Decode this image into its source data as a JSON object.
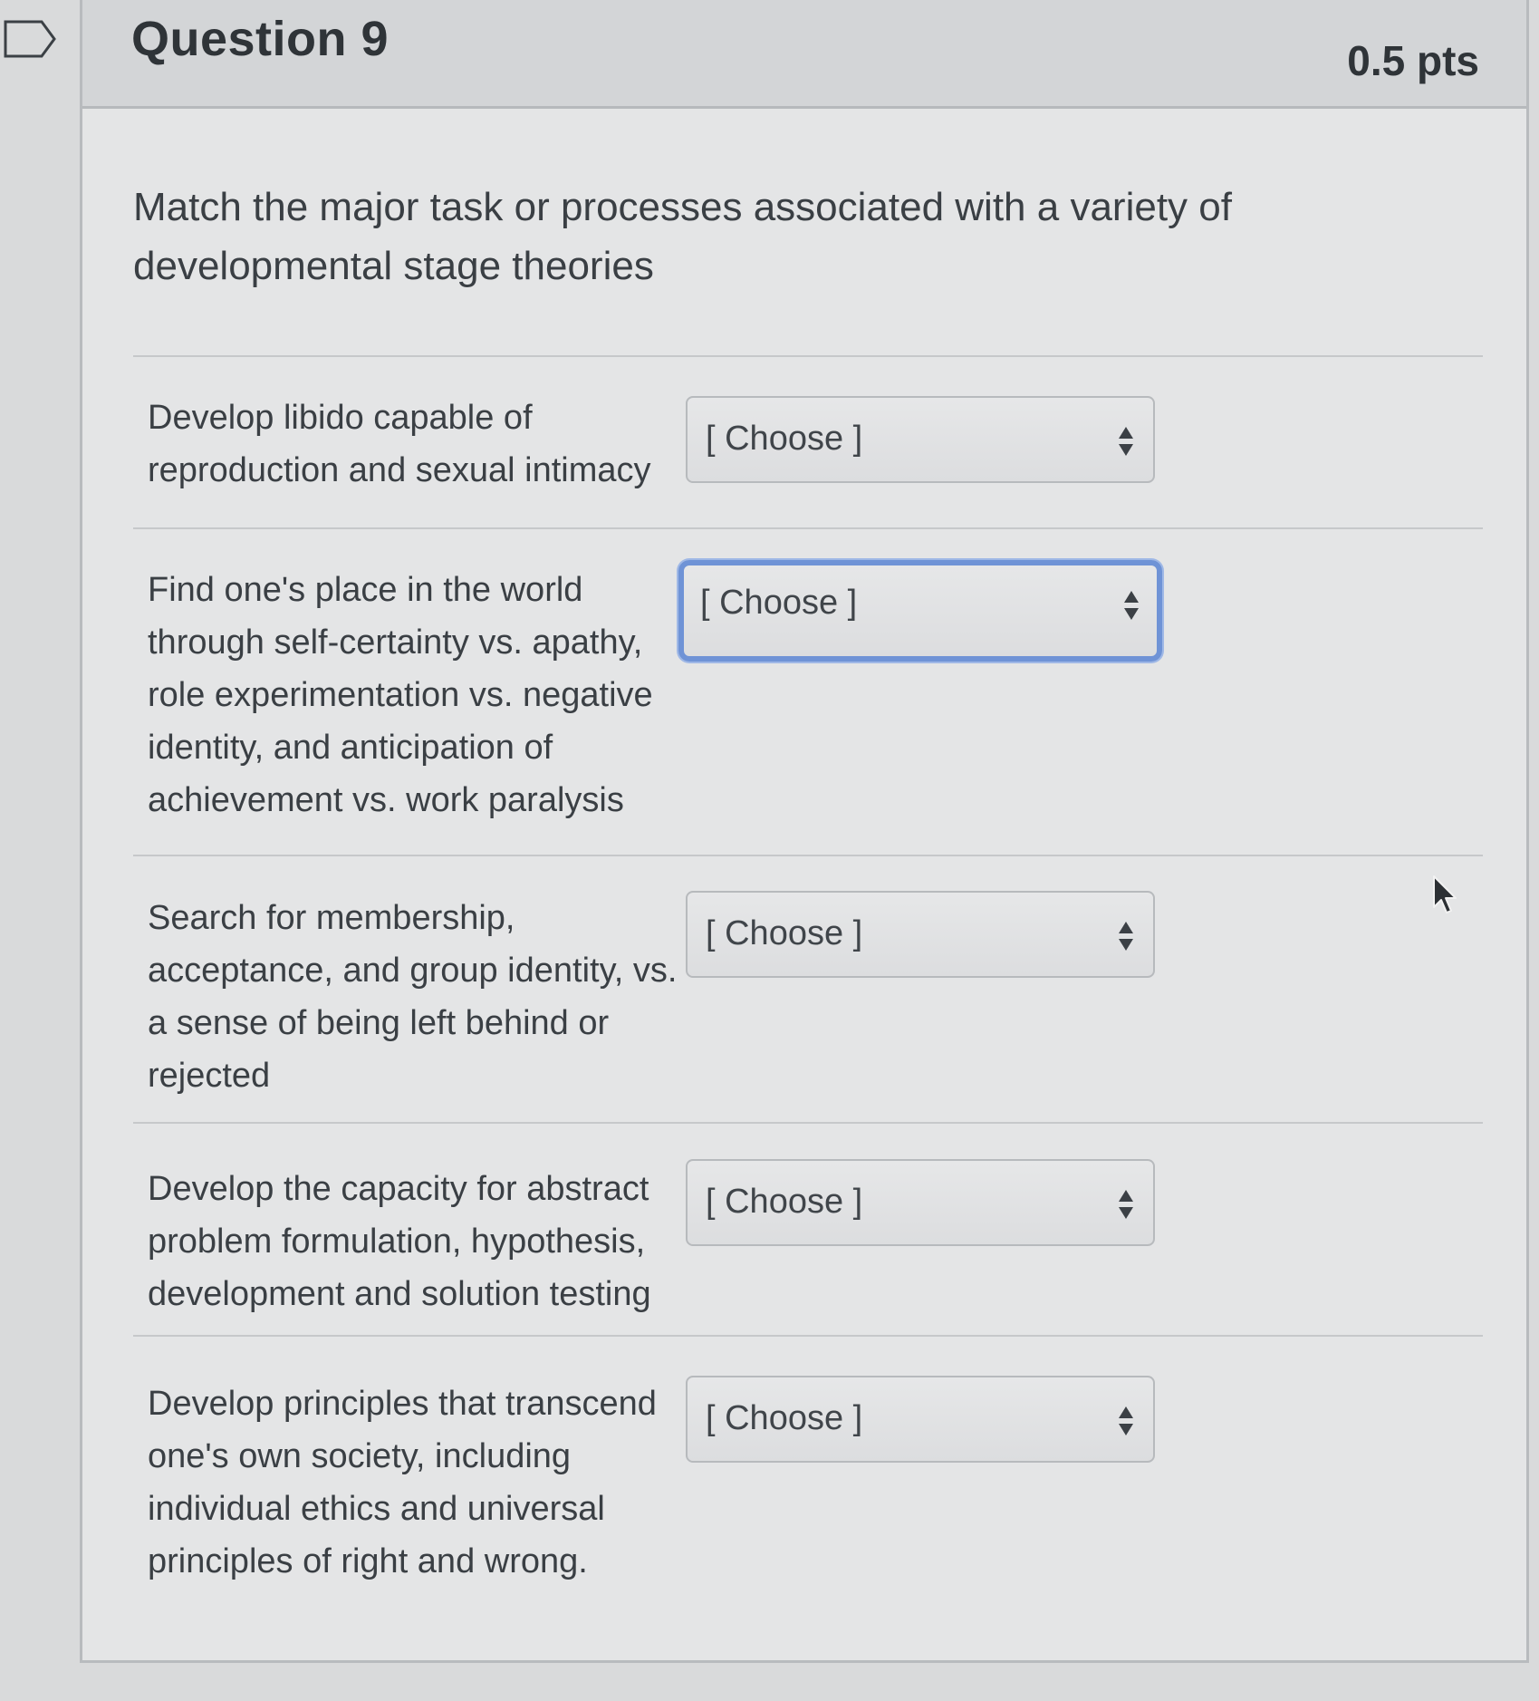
{
  "question": {
    "title": "Question 9",
    "points": "0.5 pts",
    "prompt": "Match the major task or processes associated with a variety of developmental stage theories"
  },
  "icons": {
    "flag": "flag-outline-icon",
    "select_arrows": "up-down-arrows-icon",
    "cursor": "mouse-pointer-icon"
  },
  "matches": [
    {
      "label": "Develop libido capable of reproduction and sexual intimacy",
      "selected": "[ Choose ]",
      "focused": false
    },
    {
      "label": "Find one's place in the world through self-certainty vs. apathy, role experimentation vs. negative identity, and anticipation of achievement vs. work paralysis",
      "selected": "[ Choose ]",
      "focused": true
    },
    {
      "label": "Search for membership, acceptance, and group identity, vs. a sense of being left behind or rejected",
      "selected": "[ Choose ]",
      "focused": false
    },
    {
      "label": "Develop the capacity for abstract problem formulation, hypothesis, development and solution testing",
      "selected": "[ Choose ]",
      "focused": false
    },
    {
      "label": "Develop principles that transcend one's own society, including individual ethics and universal principles of right and wrong.",
      "selected": "[ Choose ]",
      "focused": false
    }
  ],
  "colors": {
    "focus_ring": "#6f93d6",
    "page_bg": "#d9dadb",
    "card_bg": "#e4e5e6"
  }
}
